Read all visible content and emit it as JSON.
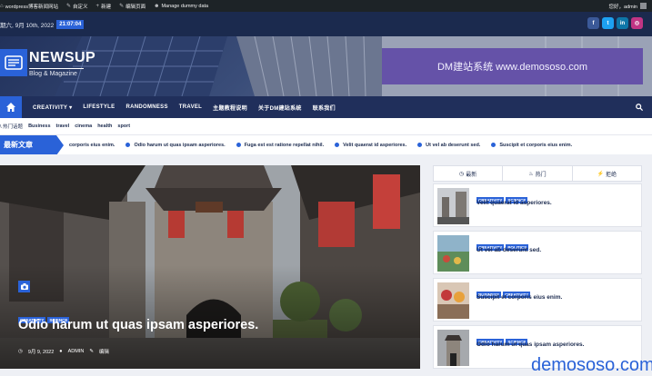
{
  "admin_bar": {
    "site": "wordpress博客新闻网站",
    "customize": "自定义",
    "new": "新建",
    "edit_page": "编辑页面",
    "manage": "Manage dummy data",
    "greeting": "您好，admin"
  },
  "top_bar": {
    "date": "期六, 9月 10th, 2022",
    "time": "21:07:04",
    "social": [
      {
        "icon": "facebook-icon",
        "glyph": "f",
        "color": "#3b5998"
      },
      {
        "icon": "twitter-icon",
        "glyph": "t",
        "color": "#1da1f2"
      },
      {
        "icon": "linkedin-icon",
        "glyph": "in",
        "color": "#0e76a8"
      },
      {
        "icon": "instagram-icon",
        "glyph": "◎",
        "color": "#c13584"
      }
    ]
  },
  "brand": {
    "name": "NEWSUP",
    "tagline": "Blog & Magazine",
    "ad_text": "DM建站系统 www.demososo.com"
  },
  "nav": {
    "items": [
      "CREATIVITY ▾",
      "LIFESTYLE",
      "RANDOMNESS",
      "TRAVEL",
      "主题教程说明",
      "关于DM建站系统",
      "联系我们"
    ]
  },
  "tags_bar": {
    "label": "\\ 热门话题",
    "tags": [
      "Business",
      "travel",
      "cinema",
      "health",
      "sport"
    ]
  },
  "ticker": {
    "label": "最新文章",
    "items": [
      "corporis eius enim.",
      "Odio harum ut quas ipsam asperiores.",
      "Fuga est est ratione repellat nihil.",
      "Velit quaerat id asperiores.",
      "Ut vel ab deserunt sed.",
      "Suscipit et corporis eius enim."
    ]
  },
  "hero": {
    "badges": [
      "CREATIVITY",
      "SCIENCE"
    ],
    "title": "Odio harum ut quas ipsam asperiores.",
    "date": "9月 9, 2022",
    "author": "ADMIN",
    "edit": "编辑"
  },
  "sidebar": {
    "tabs": [
      {
        "icon": "clock-icon",
        "glyph": "◷",
        "label": "最新"
      },
      {
        "icon": "fire-icon",
        "glyph": "♨",
        "label": "热门"
      },
      {
        "icon": "bolt-icon",
        "glyph": "⚡",
        "label": "拒绝"
      }
    ],
    "posts": [
      {
        "badges": [
          "CREATIVITY",
          "SCIENCE"
        ],
        "title": "Velit quaerat id asperiores."
      },
      {
        "badges": [
          "CREATIVITY",
          "POLITICS"
        ],
        "title": "Ut vel ab deserunt sed."
      },
      {
        "badges": [
          "BUSINESS",
          "CREATIVITY"
        ],
        "title": "Suscipit et corporis eius enim."
      },
      {
        "badges": [
          "CREATIVITY",
          "SCIENCE"
        ],
        "title": "Odio harum ut quas ipsam asperiores."
      }
    ]
  },
  "watermark": "demososo.com"
}
